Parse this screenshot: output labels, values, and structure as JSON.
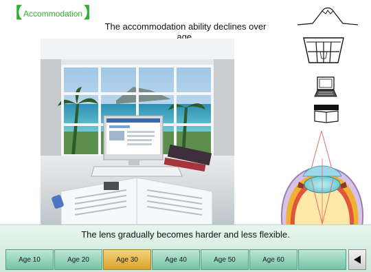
{
  "section_tag": {
    "label": "Accommodation"
  },
  "headline": "The accommodation ability declines over age.",
  "caption": "The lens gradually becomes harder and less flexible.",
  "age_tabs": [
    {
      "label": "Age 10",
      "active": false
    },
    {
      "label": "Age 20",
      "active": false
    },
    {
      "label": "Age 30",
      "active": true
    },
    {
      "label": "Age 40",
      "active": false
    },
    {
      "label": "Age 50",
      "active": false
    },
    {
      "label": "Age 60",
      "active": false
    }
  ],
  "icons": {
    "distance_icons": [
      "mountain-icon",
      "window-icon",
      "laptop-icon",
      "book-icon"
    ],
    "back": "triangle-left-icon"
  },
  "colors": {
    "accent_green": "#2fae2c",
    "tab_green": "#72c3a6",
    "tab_active": "#d9a22c"
  }
}
